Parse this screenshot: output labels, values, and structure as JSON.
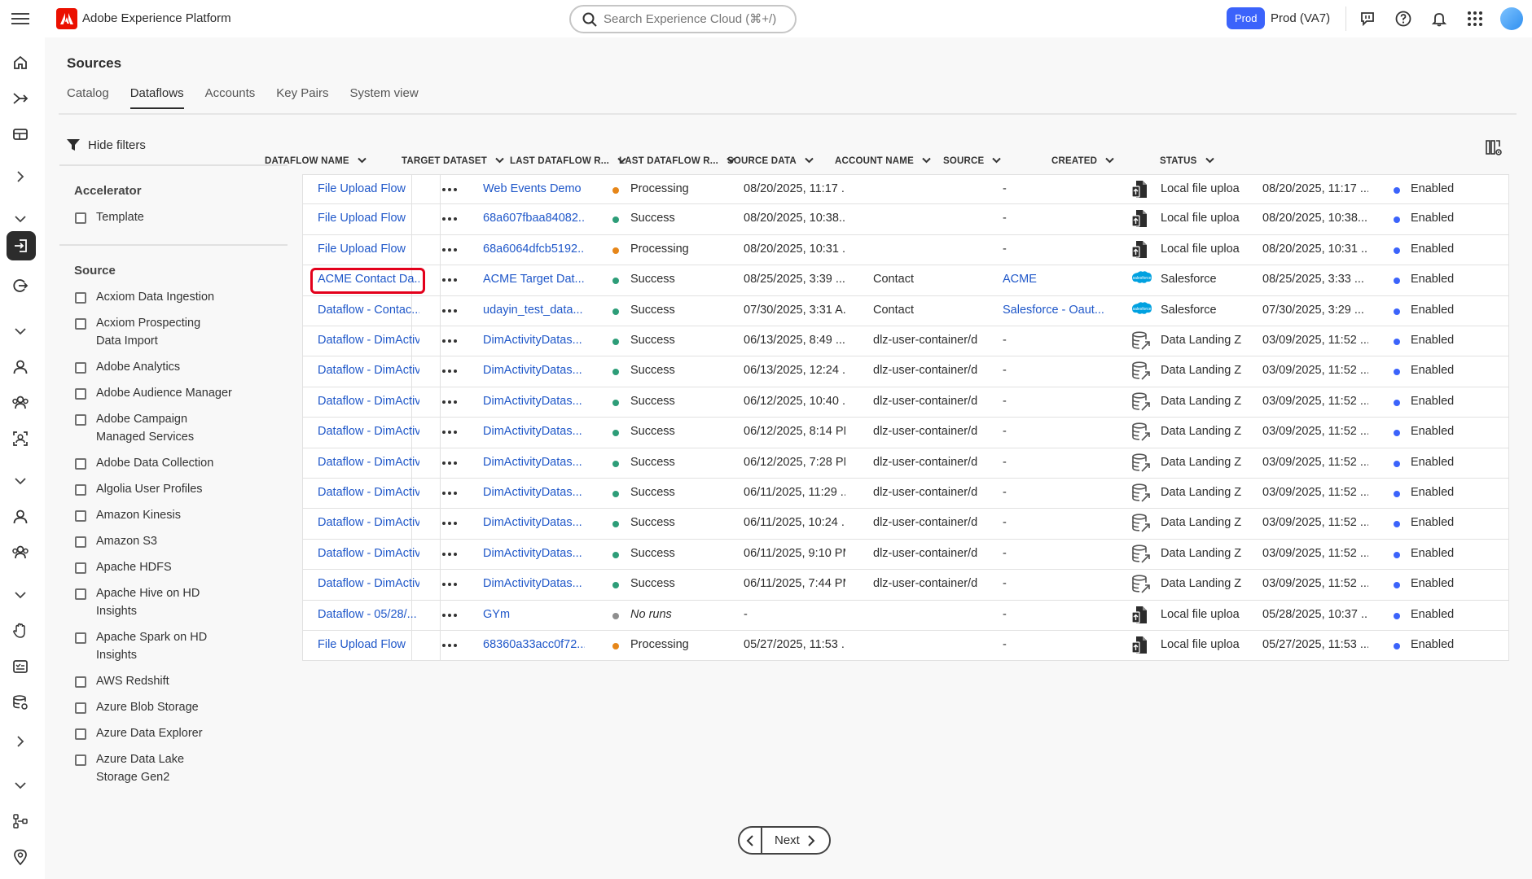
{
  "app": {
    "title": "Adobe Experience Platform"
  },
  "search": {
    "placeholder": "Search Experience Cloud (⌘+/)"
  },
  "org": {
    "badge": "Prod",
    "sandbox": "Prod (VA7)"
  },
  "page": {
    "title": "Sources"
  },
  "tabs": [
    {
      "label": "Catalog",
      "active": false
    },
    {
      "label": "Dataflows",
      "active": true
    },
    {
      "label": "Accounts",
      "active": false
    },
    {
      "label": "Key Pairs",
      "active": false
    },
    {
      "label": "System view",
      "active": false
    }
  ],
  "filters": {
    "toggle_label": "Hide filters",
    "accelerator_heading": "Accelerator",
    "accelerator_items": [
      "Template"
    ],
    "source_heading": "Source",
    "source_items": [
      "Acxiom Data Ingestion",
      "Acxiom Prospecting Data Import",
      "Adobe Analytics",
      "Adobe Audience Manager",
      "Adobe Campaign Managed Services",
      "Adobe Data Collection",
      "Algolia User Profiles",
      "Amazon Kinesis",
      "Amazon S3",
      "Apache HDFS",
      "Apache Hive on HD Insights",
      "Apache Spark on HD Insights",
      "AWS Redshift",
      "Azure Blob Storage",
      "Azure Data Explorer",
      "Azure Data Lake Storage Gen2"
    ]
  },
  "table": {
    "columns": [
      "DATAFLOW NAME",
      "TARGET DATASET",
      "LAST DATAFLOW R...",
      "LAST DATAFLOW R...",
      "SOURCE DATA",
      "ACCOUNT NAME",
      "SOURCE",
      "CREATED",
      "STATUS"
    ],
    "rows": [
      {
        "name": "File Upload Flow",
        "dataset": "Web Events Demo",
        "run_status": "Processing",
        "run_color": "#e68619",
        "run_time": "08/20/2025, 11:17 ...",
        "source_data": "",
        "account": "-",
        "account_link": false,
        "source": "Local file uploa",
        "source_icon": "file-upload-icon",
        "created": "08/20/2025, 11:17 ...",
        "status": "Enabled"
      },
      {
        "name": "File Upload Flow",
        "dataset": "68a607fbaa84082...",
        "run_status": "Success",
        "run_color": "#2d9d78",
        "run_time": "08/20/2025, 10:38...",
        "source_data": "",
        "account": "-",
        "account_link": false,
        "source": "Local file uploa",
        "source_icon": "file-upload-icon",
        "created": "08/20/2025, 10:38...",
        "status": "Enabled"
      },
      {
        "name": "File Upload Flow",
        "dataset": "68a6064dfcb5192...",
        "run_status": "Processing",
        "run_color": "#e68619",
        "run_time": "08/20/2025, 10:31 ...",
        "source_data": "",
        "account": "-",
        "account_link": false,
        "source": "Local file uploa",
        "source_icon": "file-upload-icon",
        "created": "08/20/2025, 10:31 ...",
        "status": "Enabled"
      },
      {
        "name": "ACME Contact Da...",
        "dataset": "ACME Target Dat...",
        "run_status": "Success",
        "run_color": "#2d9d78",
        "run_time": "08/25/2025, 3:39 ...",
        "source_data": "Contact",
        "account": "ACME",
        "account_link": true,
        "source": "Salesforce",
        "source_icon": "salesforce-icon",
        "created": "08/25/2025, 3:33 ...",
        "status": "Enabled"
      },
      {
        "name": "Dataflow - Contac...",
        "dataset": "udayin_test_data...",
        "run_status": "Success",
        "run_color": "#2d9d78",
        "run_time": "07/30/2025, 3:31 A...",
        "source_data": "Contact",
        "account": "Salesforce - Oaut...",
        "account_link": true,
        "source": "Salesforce",
        "source_icon": "salesforce-icon",
        "created": "07/30/2025, 3:29 ...",
        "status": "Enabled"
      },
      {
        "name": "Dataflow - DimActivi",
        "dataset": "DimActivityDatas...",
        "run_status": "Success",
        "run_color": "#2d9d78",
        "run_time": "06/13/2025, 8:49 ...",
        "source_data": "dlz-user-container/di",
        "account": "-",
        "account_link": false,
        "source": "Data Landing Z",
        "source_icon": "data-landing-zone-icon",
        "created": "03/09/2025, 11:52 ...",
        "status": "Enabled"
      },
      {
        "name": "Dataflow - DimActivi",
        "dataset": "DimActivityDatas...",
        "run_status": "Success",
        "run_color": "#2d9d78",
        "run_time": "06/13/2025, 12:24 ...",
        "source_data": "dlz-user-container/di",
        "account": "-",
        "account_link": false,
        "source": "Data Landing Z",
        "source_icon": "data-landing-zone-icon",
        "created": "03/09/2025, 11:52 ...",
        "status": "Enabled"
      },
      {
        "name": "Dataflow - DimActivi",
        "dataset": "DimActivityDatas...",
        "run_status": "Success",
        "run_color": "#2d9d78",
        "run_time": "06/12/2025, 10:40 ...",
        "source_data": "dlz-user-container/di",
        "account": "-",
        "account_link": false,
        "source": "Data Landing Z",
        "source_icon": "data-landing-zone-icon",
        "created": "03/09/2025, 11:52 ...",
        "status": "Enabled"
      },
      {
        "name": "Dataflow - DimActivi",
        "dataset": "DimActivityDatas...",
        "run_status": "Success",
        "run_color": "#2d9d78",
        "run_time": "06/12/2025, 8:14 PM",
        "source_data": "dlz-user-container/di",
        "account": "-",
        "account_link": false,
        "source": "Data Landing Z",
        "source_icon": "data-landing-zone-icon",
        "created": "03/09/2025, 11:52 ...",
        "status": "Enabled"
      },
      {
        "name": "Dataflow - DimActivi",
        "dataset": "DimActivityDatas...",
        "run_status": "Success",
        "run_color": "#2d9d78",
        "run_time": "06/12/2025, 7:28 PM",
        "source_data": "dlz-user-container/di",
        "account": "-",
        "account_link": false,
        "source": "Data Landing Z",
        "source_icon": "data-landing-zone-icon",
        "created": "03/09/2025, 11:52 ...",
        "status": "Enabled"
      },
      {
        "name": "Dataflow - DimActivi",
        "dataset": "DimActivityDatas...",
        "run_status": "Success",
        "run_color": "#2d9d78",
        "run_time": "06/11/2025, 11:29 ...",
        "source_data": "dlz-user-container/di",
        "account": "-",
        "account_link": false,
        "source": "Data Landing Z",
        "source_icon": "data-landing-zone-icon",
        "created": "03/09/2025, 11:52 ...",
        "status": "Enabled"
      },
      {
        "name": "Dataflow - DimActivi",
        "dataset": "DimActivityDatas...",
        "run_status": "Success",
        "run_color": "#2d9d78",
        "run_time": "06/11/2025, 10:24 ...",
        "source_data": "dlz-user-container/di",
        "account": "-",
        "account_link": false,
        "source": "Data Landing Z",
        "source_icon": "data-landing-zone-icon",
        "created": "03/09/2025, 11:52 ...",
        "status": "Enabled"
      },
      {
        "name": "Dataflow - DimActivi",
        "dataset": "DimActivityDatas...",
        "run_status": "Success",
        "run_color": "#2d9d78",
        "run_time": "06/11/2025, 9:10 PM",
        "source_data": "dlz-user-container/di",
        "account": "-",
        "account_link": false,
        "source": "Data Landing Z",
        "source_icon": "data-landing-zone-icon",
        "created": "03/09/2025, 11:52 ...",
        "status": "Enabled"
      },
      {
        "name": "Dataflow - DimActivi",
        "dataset": "DimActivityDatas...",
        "run_status": "Success",
        "run_color": "#2d9d78",
        "run_time": "06/11/2025, 7:44 PM",
        "source_data": "dlz-user-container/di",
        "account": "-",
        "account_link": false,
        "source": "Data Landing Z",
        "source_icon": "data-landing-zone-icon",
        "created": "03/09/2025, 11:52 ...",
        "status": "Enabled"
      },
      {
        "name": "Dataflow - 05/28/...",
        "dataset": "GYm",
        "run_status": "No runs",
        "run_color": "#8e8e8e",
        "run_italic": true,
        "run_time": "-",
        "source_data": "",
        "account": "-",
        "account_link": false,
        "source": "Local file uploa",
        "source_icon": "file-upload-icon",
        "created": "05/28/2025, 10:37 ...",
        "status": "Enabled"
      },
      {
        "name": "File Upload Flow",
        "dataset": "68360a33acc0f72...",
        "run_status": "Processing",
        "run_color": "#e68619",
        "run_time": "05/27/2025, 11:53 ...",
        "source_data": "",
        "account": "-",
        "account_link": false,
        "source": "Local file uploa",
        "source_icon": "file-upload-icon",
        "created": "05/27/2025, 11:53 ...",
        "status": "Enabled"
      }
    ],
    "highlighted_row": 3
  },
  "pagination": {
    "next_label": "Next"
  },
  "colors": {
    "link": "#1f57c9",
    "enabled": "#3b63fb",
    "success": "#2d9d78",
    "processing": "#e68619",
    "highlight": "#e3001b",
    "brand": "#eb1000"
  }
}
